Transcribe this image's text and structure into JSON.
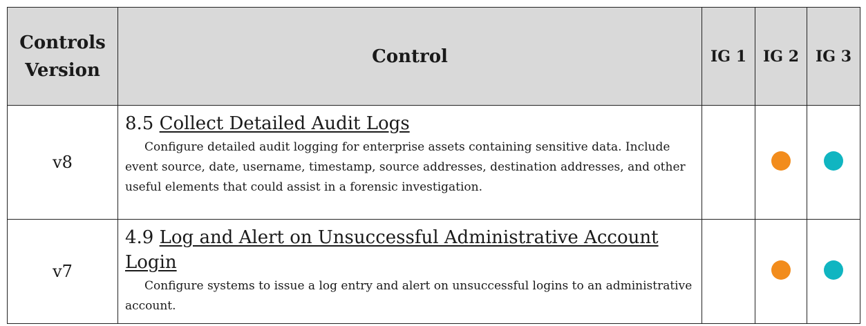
{
  "header": {
    "version_line1": "Controls",
    "version_line2": "Version",
    "control": "Control",
    "ig1": "IG 1",
    "ig2": "IG 2",
    "ig3": "IG 3"
  },
  "rows": [
    {
      "version": "v8",
      "number": "8.5",
      "title": "Collect Detailed Audit Logs",
      "description": "Configure detailed audit logging for enterprise assets containing sensitive data. Include event source, date, username, timestamp, source addresses, destination addresses, and other useful elements that could assist in a forensic investigation.",
      "ig1": false,
      "ig2": true,
      "ig3": true
    },
    {
      "version": "v7",
      "number": "4.9",
      "title": "Log and Alert on Unsuccessful Administrative Account Login",
      "description": "Configure systems to issue a log entry and alert on unsuccessful logins to an administrative account.",
      "ig1": false,
      "ig2": true,
      "ig3": true
    }
  ],
  "colors": {
    "ig2_dot": "#f28c1c",
    "ig3_dot": "#10b5c1",
    "header_bg": "#d9d9d9"
  }
}
